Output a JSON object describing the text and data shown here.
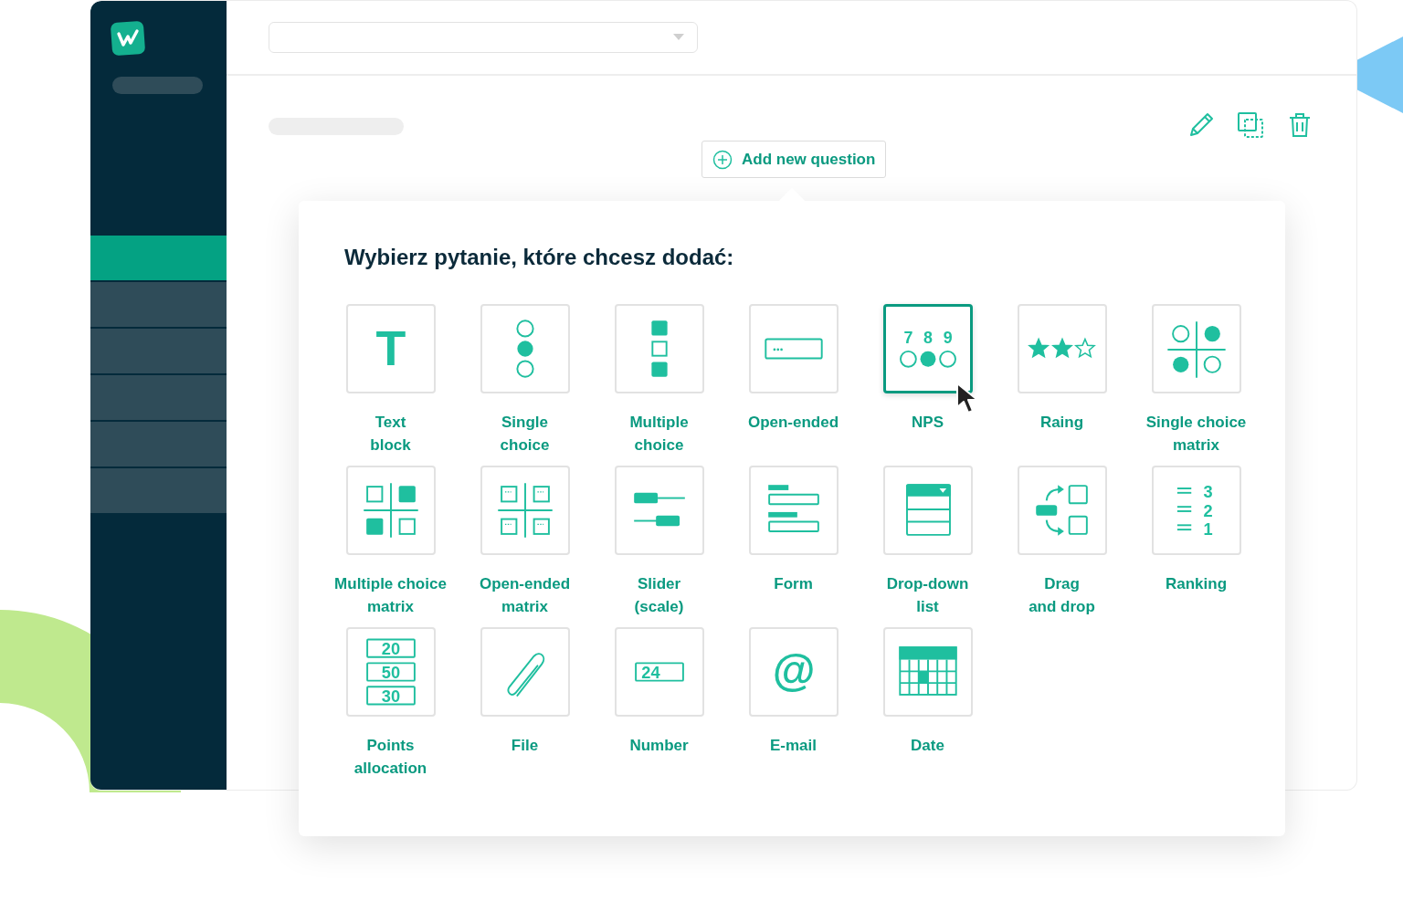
{
  "sidebar": {
    "items": [
      {
        "selected": true
      },
      {
        "selected": false
      },
      {
        "selected": false
      },
      {
        "selected": false
      },
      {
        "selected": false
      },
      {
        "selected": false
      }
    ]
  },
  "add_button": {
    "label": "Add new question"
  },
  "picker": {
    "title": "Wybierz pytanie, które chcesz dodać:",
    "questions": [
      {
        "kind": "text",
        "label": "Text\nblock",
        "icon_text": [
          "T"
        ],
        "selected": false
      },
      {
        "kind": "single",
        "label": "Single\nchoice",
        "selected": false
      },
      {
        "kind": "multiple",
        "label": "Multiple\nchoice",
        "selected": false
      },
      {
        "kind": "open",
        "label": "Open-ended",
        "selected": false
      },
      {
        "kind": "nps",
        "label": "NPS",
        "icon_text": [
          "7",
          "8",
          "9"
        ],
        "selected": true
      },
      {
        "kind": "rating",
        "label": "Raing",
        "selected": false
      },
      {
        "kind": "single_matrix",
        "label": "Single choice\nmatrix",
        "selected": false
      },
      {
        "kind": "multi_matrix",
        "label": "Multiple choice\nmatrix",
        "selected": false
      },
      {
        "kind": "open_matrix",
        "label": "Open-ended\nmatrix",
        "selected": false
      },
      {
        "kind": "slider",
        "label": "Slider\n(scale)",
        "selected": false
      },
      {
        "kind": "form",
        "label": "Form",
        "selected": false
      },
      {
        "kind": "dropdown",
        "label": "Drop-down\nlist",
        "selected": false
      },
      {
        "kind": "dragdrop",
        "label": "Drag\nand drop",
        "selected": false
      },
      {
        "kind": "ranking",
        "label": "Ranking",
        "icon_text": [
          "3",
          "2",
          "1"
        ],
        "selected": false
      },
      {
        "kind": "points",
        "label": "Points\nallocation",
        "icon_text": [
          "20",
          "50",
          "30"
        ],
        "selected": false
      },
      {
        "kind": "file",
        "label": "File",
        "selected": false
      },
      {
        "kind": "number",
        "label": "Number",
        "icon_text": [
          "24"
        ],
        "selected": false
      },
      {
        "kind": "email",
        "label": "E-mail",
        "icon_text": [
          "@"
        ],
        "selected": false
      },
      {
        "kind": "date",
        "label": "Date",
        "selected": false
      }
    ]
  }
}
